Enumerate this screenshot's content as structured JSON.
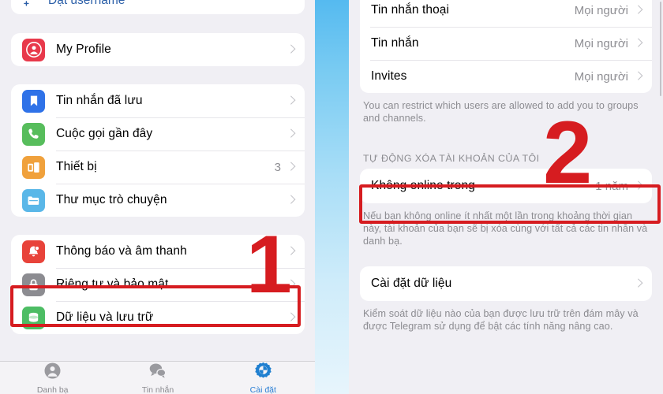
{
  "left_panel": {
    "partial_top_row": {
      "label": "Đặt username",
      "icon": "add-user-icon"
    },
    "profile_card": [
      {
        "label": "My Profile",
        "icon": "profile-icon",
        "value": "",
        "chevron": true
      }
    ],
    "main_card": [
      {
        "label": "Tin nhắn đã lưu",
        "icon": "bookmark-icon",
        "value": "",
        "chevron": true
      },
      {
        "label": "Cuộc gọi gần đây",
        "icon": "phone-icon",
        "value": "",
        "chevron": true
      },
      {
        "label": "Thiết bị",
        "icon": "devices-icon",
        "value": "3",
        "chevron": true
      },
      {
        "label": "Thư mục trò chuyện",
        "icon": "folder-icon",
        "value": "",
        "chevron": true
      }
    ],
    "settings_card": [
      {
        "label": "Thông báo và âm thanh",
        "icon": "bell-icon",
        "value": "",
        "chevron": true
      },
      {
        "label": "Riêng tư và bảo mật",
        "icon": "lock-icon",
        "value": "",
        "chevron": true
      },
      {
        "label": "Dữ liệu và lưu trữ",
        "icon": "database-icon",
        "value": "",
        "chevron": true
      }
    ],
    "tabbar": [
      {
        "label": "Danh bạ",
        "icon": "contacts-icon",
        "active": false
      },
      {
        "label": "Tin nhắn",
        "icon": "chats-icon",
        "active": false
      },
      {
        "label": "Cài đặt",
        "icon": "settings-gear-icon",
        "active": true
      }
    ]
  },
  "right_panel": {
    "privacy_card": [
      {
        "label": "Tin nhắn thoại",
        "value": "Mọi người",
        "chevron": true
      },
      {
        "label": "Tin nhắn",
        "value": "Mọi người",
        "chevron": true
      },
      {
        "label": "Invites",
        "value": "Mọi người",
        "chevron": true
      }
    ],
    "privacy_note": "You can restrict which users are allowed to add you to groups and channels.",
    "autodelete_section_header": "TỰ ĐỘNG XÓA TÀI KHOẢN CỦA TÔI",
    "autodelete_card": [
      {
        "label": "Không online trong",
        "value": "1 năm",
        "chevron": true
      }
    ],
    "autodelete_note": "Nếu bạn không online ít nhất một lần trong khoảng thời gian này, tài khoản của bạn sẽ bị xóa cùng với tất cả các tin nhắn và danh bạ.",
    "data_card": [
      {
        "label": "Cài đặt dữ liệu",
        "value": "",
        "chevron": true
      }
    ],
    "data_note": "Kiểm soát dữ liệu nào của bạn được lưu trữ trên đám mây và được Telegram sử dụng để bật các tính năng nâng cao."
  },
  "annotations": {
    "step_one": "1",
    "step_two": "2",
    "highlight_color": "#d61c20"
  },
  "colors": {
    "panel_bg": "#f0eff4",
    "card_bg": "#ffffff",
    "accent_blue": "#2b7fd4",
    "separator_blue": "#55baf0",
    "muted_text": "#8e8e93",
    "icon_red": "#e8394b",
    "icon_blue": "#2f72e8",
    "icon_green": "#57bd5c",
    "icon_orange": "#f0a13c",
    "icon_lightblue": "#5ab7e8",
    "icon_bellred": "#e8433a",
    "icon_gray": "#8c8c91",
    "icon_greendb": "#4dbd64"
  }
}
